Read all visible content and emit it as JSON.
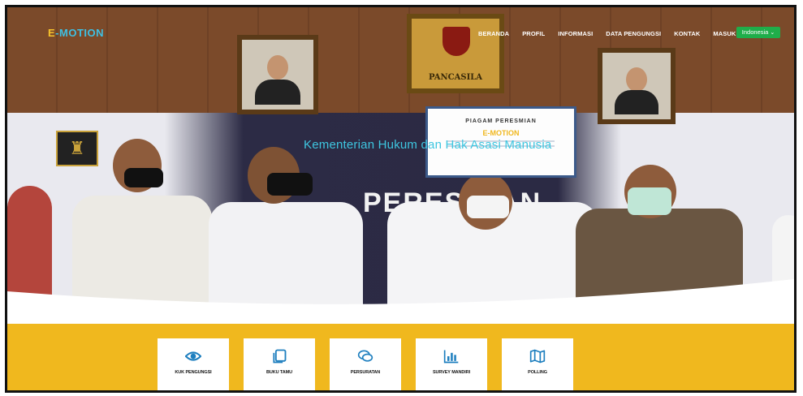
{
  "brand": {
    "e": "E",
    "rest": "-MOTION"
  },
  "nav": {
    "items": [
      {
        "label": "BERANDA"
      },
      {
        "label": "PROFIL"
      },
      {
        "label": "INFORMASI"
      },
      {
        "label": "DATA PENGUNGSI"
      },
      {
        "label": "KONTAK"
      },
      {
        "label": "MASUK"
      }
    ],
    "language": "Indonesia"
  },
  "hero": {
    "title": "Kementerian Hukum dan Hak Asasi Manusia",
    "certificate_heading": "PIAGAM PERESMIAN",
    "certificate_brand": "E-MOTION",
    "backdrop_text": "PERESMIAN",
    "garuda_label": "PANCASILA"
  },
  "cards": [
    {
      "label": "KUK PENGUNGSI",
      "icon": "eye-icon"
    },
    {
      "label": "BUKU TAMU",
      "icon": "copy-icon"
    },
    {
      "label": "PERSURATAN",
      "icon": "chat-icon"
    },
    {
      "label": "SURVEY MANDIRI",
      "icon": "bar-chart-icon"
    },
    {
      "label": "POLLING",
      "icon": "map-icon"
    }
  ],
  "colors": {
    "accent_yellow": "#f0b81e",
    "brand_cyan": "#3fc0e3",
    "language_green": "#1fae4a"
  }
}
